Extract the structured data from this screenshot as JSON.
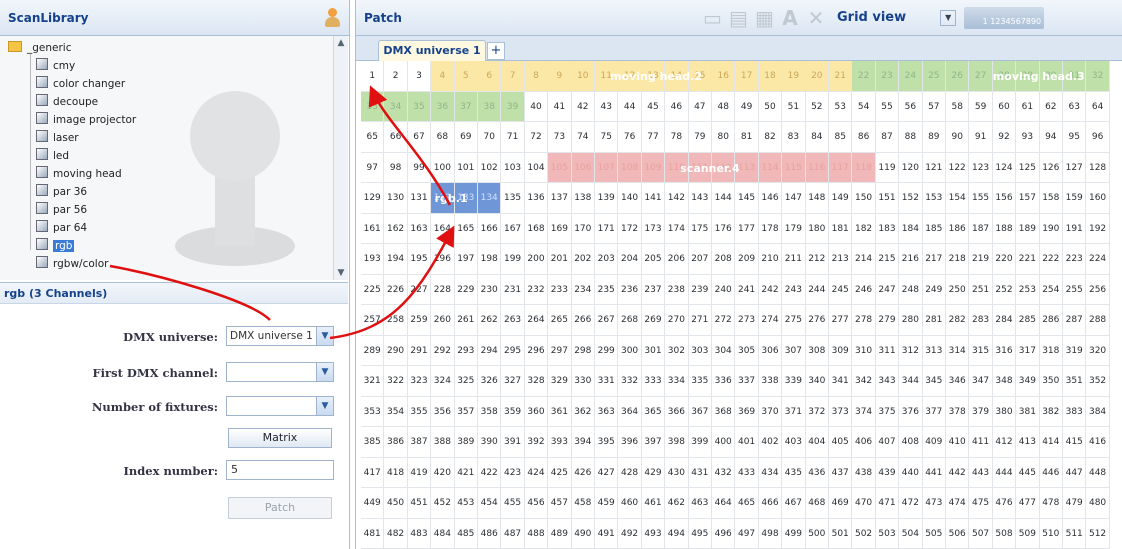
{
  "left_panel": {
    "title": "ScanLibrary",
    "tree": {
      "root": "_generic",
      "items": [
        "cmy",
        "color changer",
        "decoupe",
        "image projector",
        "laser",
        "led",
        "moving head",
        "par 36",
        "par 56",
        "par 64",
        "rgb",
        "rgbw/color"
      ],
      "selected": "rgb"
    },
    "selection_caption": "rgb (3 Channels)",
    "form": {
      "dmx_universe_label": "DMX universe:",
      "dmx_universe_value": "DMX universe 1",
      "first_channel_label": "First DMX channel:",
      "first_channel_value": "",
      "fixtures_label": "Number of fixtures:",
      "fixtures_value": "",
      "matrix_button": "Matrix",
      "index_label": "Index number:",
      "index_value": "5",
      "patch_button": "Patch"
    }
  },
  "right_panel": {
    "title": "Patch",
    "toolbar_icons": [
      "copy-icon",
      "paste-icon",
      "paste-special-icon",
      "rename-icon",
      "delete-icon"
    ],
    "view_label": "Grid view",
    "counter_text": "1 1234567890",
    "tab_label": "DMX universe 1",
    "add_tab": "+",
    "grid": {
      "columns": 32,
      "rows": 16,
      "fixtures": [
        {
          "label": "moving head.2",
          "start": 4,
          "end": 21,
          "color": "yellow"
        },
        {
          "label": "moving head.3",
          "start": 22,
          "end": 39,
          "color": "green"
        },
        {
          "label": "scanner.4",
          "start": 105,
          "end": 118,
          "color": "red"
        },
        {
          "label": "rgb.1",
          "start": 132,
          "end": 134,
          "color": "blue"
        }
      ]
    }
  },
  "colors": {
    "yellow": "#fbe7a6",
    "green": "#bfe0a8",
    "red": "#f0b8b8",
    "blue": "#6f96d6",
    "arrow": "#e01010"
  }
}
